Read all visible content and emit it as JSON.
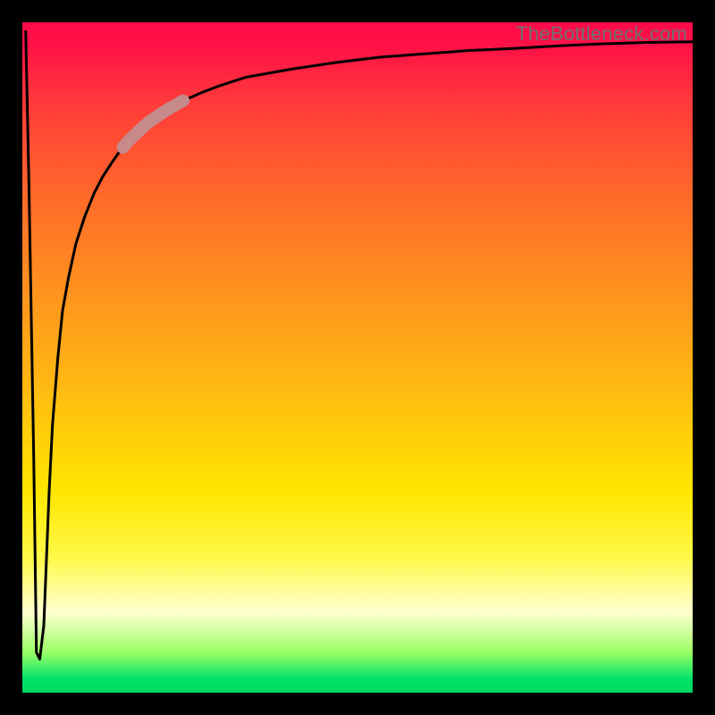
{
  "attribution": "TheBottleneck.com",
  "chart_data": {
    "type": "line",
    "title": "",
    "xlabel": "",
    "ylabel": "",
    "xlim": [
      0,
      100
    ],
    "ylim": [
      0,
      100
    ],
    "gradient_stops": [
      {
        "pos": 0,
        "color": "#ff0a4a"
      },
      {
        "pos": 12,
        "color": "#ff3a3a"
      },
      {
        "pos": 40,
        "color": "#ff921e"
      },
      {
        "pos": 70,
        "color": "#ffe600"
      },
      {
        "pos": 88,
        "color": "#ffffd0"
      },
      {
        "pos": 95,
        "color": "#30ff60"
      },
      {
        "pos": 100,
        "color": "#00d760"
      }
    ],
    "highlight_segment": {
      "x_start": 15,
      "x_end": 24,
      "y_start": 78,
      "y_end": 85
    },
    "series": [
      {
        "name": "curve",
        "x": [
          0.5,
          1.0,
          1.7,
          2.1,
          2.6,
          3.2,
          3.6,
          4.0,
          4.5,
          5.3,
          6.0,
          6.9,
          8.0,
          9.3,
          10.7,
          12.0,
          13.3,
          14.7,
          16.0,
          18.7,
          21.3,
          24.0,
          26.7,
          29.3,
          33.3,
          40.0,
          46.7,
          53.3,
          60.0,
          66.7,
          73.3,
          80.0,
          86.7,
          93.3,
          100.0
        ],
        "y": [
          98.8,
          75.0,
          35.0,
          6.0,
          5.0,
          10.0,
          20.0,
          30.0,
          40.0,
          50.0,
          57.0,
          62.0,
          67.0,
          71.0,
          74.5,
          77.0,
          79.0,
          81.0,
          82.5,
          85.0,
          86.8,
          88.3,
          89.5,
          90.5,
          91.8,
          93.0,
          94.0,
          94.8,
          95.3,
          95.8,
          96.1,
          96.5,
          96.8,
          97.0,
          97.1
        ]
      }
    ]
  }
}
